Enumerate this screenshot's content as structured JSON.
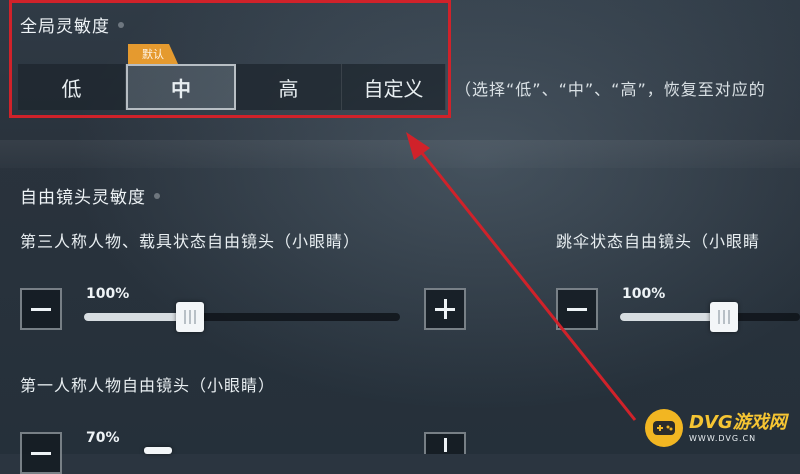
{
  "global_sensitivity": {
    "title": "全局灵敏度",
    "options": [
      "低",
      "中",
      "高",
      "自定义"
    ],
    "selected": "中",
    "default_badge": "默认",
    "hint": "（选择“低”、“中”、“高”，恢复至对应的"
  },
  "free_camera": {
    "title": "自由镜头灵敏度",
    "sliders": [
      {
        "label": "第三人称人物、载具状态自由镜头（小眼睛）",
        "value_text": "100%",
        "value": 100
      },
      {
        "label": "跳伞状态自由镜头（小眼睛",
        "value_text": "100%",
        "value": 100
      },
      {
        "label": "第一人称人物自由镜头（小眼睛）",
        "value_text": "70%",
        "value": 70
      }
    ]
  },
  "watermark": {
    "brand": "DVG游戏网",
    "url": "WWW.DVG.CN"
  },
  "colors": {
    "highlight": "#d0222a",
    "badge": "#e59a2f",
    "logo": "#f2b622"
  }
}
